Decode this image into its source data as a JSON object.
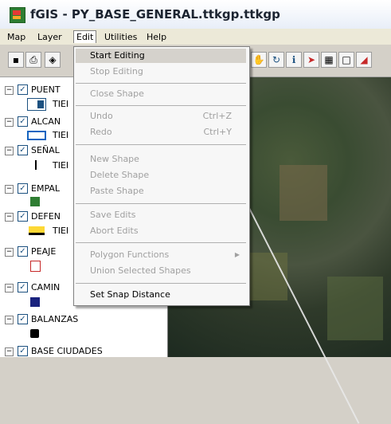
{
  "window": {
    "title": "fGIS - PY_BASE_GENERAL.ttkgp.ttkgp"
  },
  "menubar": {
    "items": [
      "Map",
      "Layer",
      "Edit",
      "Utilities",
      "Help"
    ],
    "active": "Edit"
  },
  "toolbar": {
    "icons": [
      "save-icon",
      "print-icon",
      "layer-add-icon",
      "pan-hand-icon",
      "refresh-icon",
      "info-icon",
      "select-arrow-icon",
      "table-icon",
      "rectangle-select-icon",
      "eraser-icon"
    ]
  },
  "edit_menu": {
    "items": [
      {
        "label": "Start Editing",
        "enabled": true,
        "shortcut": ""
      },
      {
        "label": "Stop Editing",
        "enabled": false,
        "shortcut": ""
      },
      {
        "label": "Close Shape",
        "enabled": false,
        "shortcut": ""
      },
      {
        "label": "Undo",
        "enabled": false,
        "shortcut": "Ctrl+Z"
      },
      {
        "label": "Redo",
        "enabled": false,
        "shortcut": "Ctrl+Y"
      },
      {
        "label": "New Shape",
        "enabled": false,
        "shortcut": ""
      },
      {
        "label": "Delete Shape",
        "enabled": false,
        "shortcut": ""
      },
      {
        "label": "Paste Shape",
        "enabled": false,
        "shortcut": ""
      },
      {
        "label": "Save Edits",
        "enabled": false,
        "shortcut": ""
      },
      {
        "label": "Abort Edits",
        "enabled": false,
        "shortcut": ""
      },
      {
        "label": "Polygon Functions",
        "enabled": false,
        "shortcut": ""
      },
      {
        "label": "Union Selected Shapes",
        "enabled": false,
        "shortcut": ""
      },
      {
        "label": "Set Snap Distance",
        "enabled": true,
        "shortcut": ""
      }
    ]
  },
  "legend": {
    "layers": [
      {
        "name": "PUENT",
        "checked": true,
        "symbol_label": "TIEI"
      },
      {
        "name": "ALCAN",
        "checked": true,
        "symbol_label": "TIEI"
      },
      {
        "name": "SEÑAL",
        "checked": true,
        "symbol_label": "TIEI"
      },
      {
        "name": "EMPAL",
        "checked": true,
        "symbol_label": ""
      },
      {
        "name": "DEFEN",
        "checked": true,
        "symbol_label": "TIEI"
      },
      {
        "name": "PEAJE",
        "checked": true,
        "symbol_label": ""
      },
      {
        "name": "CAMIN",
        "checked": true,
        "symbol_label": ""
      },
      {
        "name": "BALANZAS",
        "checked": true,
        "symbol_label": ""
      },
      {
        "name": "BASE CIUDADES",
        "checked": true,
        "symbol_label": ""
      }
    ]
  },
  "colors": {
    "menu_highlight": "#d5d2cc",
    "checkbox": "#1c5180",
    "disabled_text": "#a0a0a0"
  }
}
